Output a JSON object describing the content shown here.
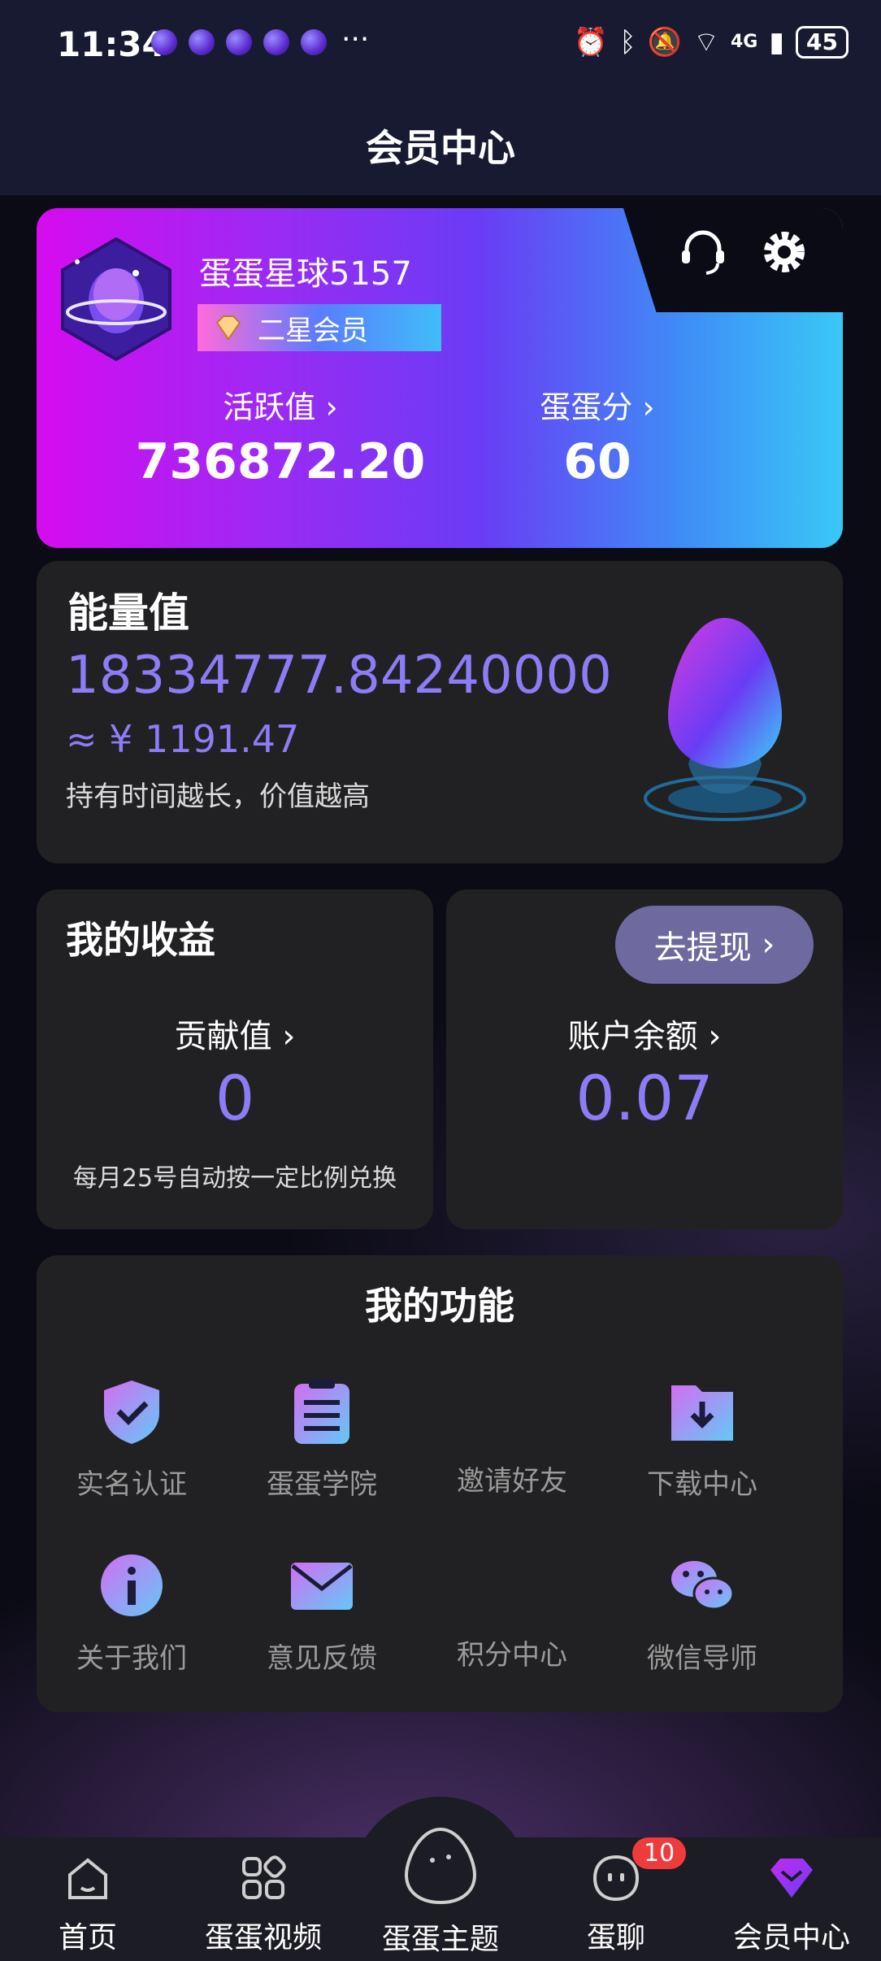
{
  "status_bar": {
    "time": "11:34",
    "more": "···",
    "network": "4G",
    "battery": "45"
  },
  "header": {
    "title": "会员中心"
  },
  "member": {
    "username": "蛋蛋星球5157",
    "level": "二星会员",
    "activity_label": "活跃值",
    "activity_value": "736872.20",
    "score_label": "蛋蛋分",
    "score_value": "60"
  },
  "energy": {
    "label": "能量值",
    "value": "18334777.84240000",
    "rmb": "≈ ¥ 1191.47",
    "note": "持有时间越长，价值越高"
  },
  "earnings": {
    "title": "我的收益",
    "contribution_label": "贡献值",
    "contribution_value": "0",
    "note": "每月25号自动按一定比例兑换"
  },
  "balance": {
    "withdraw_label": "去提现",
    "label": "账户余额",
    "value": "0.07"
  },
  "functions": {
    "title": "我的功能",
    "items": [
      {
        "label": "实名认证",
        "icon": "shield-check-icon"
      },
      {
        "label": "蛋蛋学院",
        "icon": "clipboard-icon"
      },
      {
        "label": "邀请好友",
        "icon": ""
      },
      {
        "label": "下载中心",
        "icon": "download-folder-icon"
      },
      {
        "label": "关于我们",
        "icon": "info-icon"
      },
      {
        "label": "意见反馈",
        "icon": "mail-icon"
      },
      {
        "label": "积分中心",
        "icon": ""
      },
      {
        "label": "微信导师",
        "icon": "wechat-icon"
      }
    ]
  },
  "nav": {
    "items": [
      {
        "label": "首页",
        "icon": "home-icon"
      },
      {
        "label": "蛋蛋视频",
        "icon": "grid-icon"
      },
      {
        "label": "蛋蛋主题",
        "icon": "egg-icon"
      },
      {
        "label": "蛋聊",
        "icon": "chat-icon",
        "badge": "10"
      },
      {
        "label": "会员中心",
        "icon": "diamond-icon"
      }
    ]
  },
  "colors": {
    "accent": "#8c7cf6",
    "card": "#212124",
    "background": "#0b0b15"
  }
}
